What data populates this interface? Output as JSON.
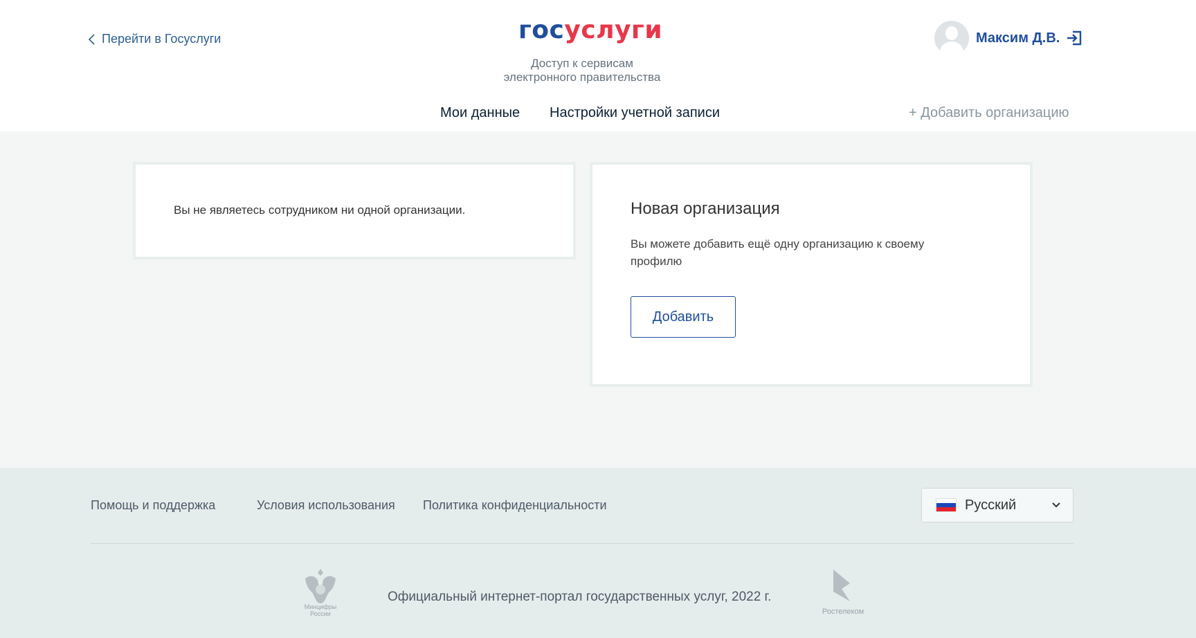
{
  "header": {
    "back_label": "Перейти в Госуслуги",
    "logo_part1": "гос",
    "logo_part2": "услуги",
    "tagline_line1": "Доступ к сервисам",
    "tagline_line2": "электронного правительства",
    "user_name": "Максим Д.В.",
    "nav": {
      "my_data": "Мои данные",
      "settings": "Настройки учетной записи"
    },
    "add_org": "+ Добавить организацию"
  },
  "main": {
    "empty_message": "Вы не являетесь сотрудником ни одной организации.",
    "new_org": {
      "title": "Новая организация",
      "description": "Вы можете добавить ещё одну организацию к своему профилю",
      "button": "Добавить"
    }
  },
  "footer": {
    "links": {
      "help": "Помощь и поддержка",
      "terms": "Условия использования",
      "privacy": "Политика конфиденциальности"
    },
    "language": "Русский",
    "emblem_caption": "Минцифры России",
    "copyright": "Официальный интернет-портал государственных услуг, 2022 г.",
    "rt_caption": "Ростелеком"
  },
  "icons": {
    "back": "chevron-left-icon",
    "logout": "logout-icon",
    "avatar": "user-avatar-icon",
    "flag": "russian-flag-icon",
    "dropdown": "chevron-down-icon",
    "emblem": "coat-of-arms-icon",
    "rostelecom": "rostelecom-logo-icon"
  },
  "colors": {
    "brand_blue": "#1f4e9c",
    "brand_red": "#e8364a",
    "main_bg": "#f4f6f6",
    "footer_bg": "#e5ecec"
  }
}
